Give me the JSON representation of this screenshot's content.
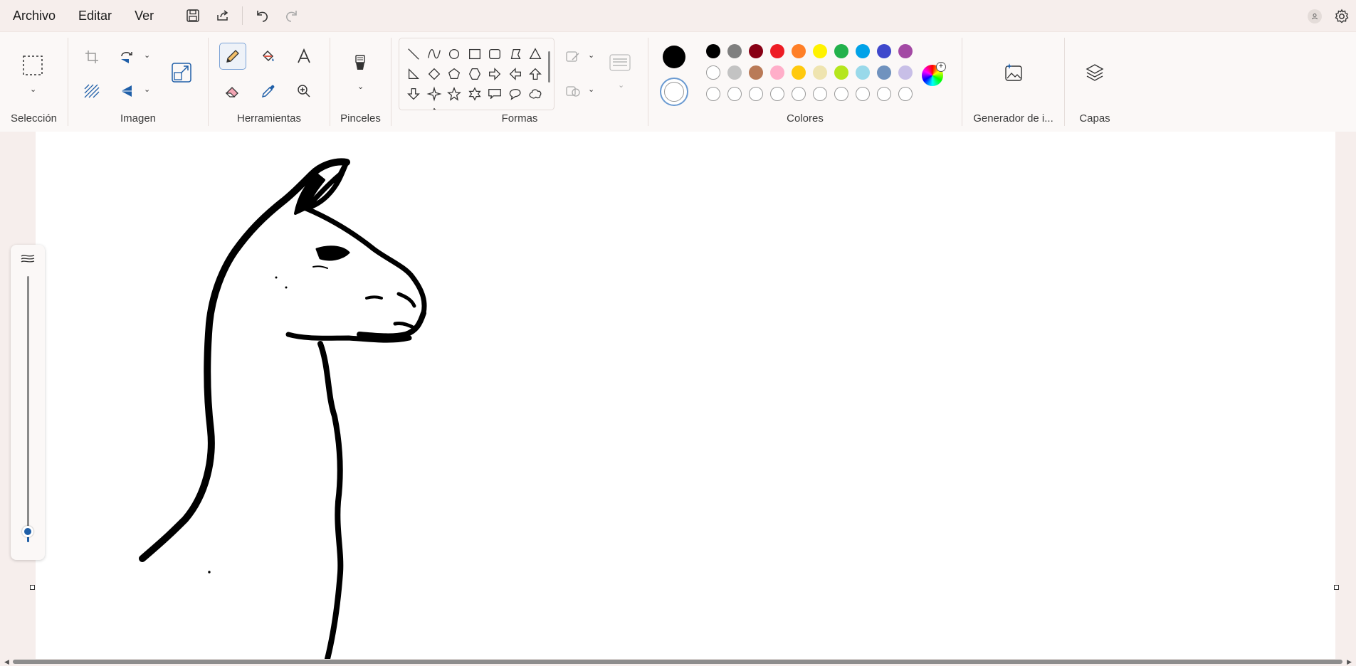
{
  "menu": {
    "items": [
      {
        "label": "Archivo",
        "name": "menu-archivo"
      },
      {
        "label": "Editar",
        "name": "menu-editar"
      },
      {
        "label": "Ver",
        "name": "menu-ver"
      }
    ]
  },
  "quick_access": [
    "save-icon",
    "share-icon",
    "undo-icon",
    "redo-icon"
  ],
  "ribbon": {
    "groups": {
      "seleccion": "Selección",
      "imagen": "Imagen",
      "herramientas": "Herramientas",
      "pinceles": "Pinceles",
      "formas": "Formas",
      "colores": "Colores",
      "generador": "Generador de i...",
      "capas": "Capas"
    },
    "active_tool": "pencil",
    "current_color_1": "#000000",
    "current_color_2": "#ffffff",
    "palette": [
      [
        "#000000",
        "#7f7f7f",
        "#880015",
        "#ed1c24",
        "#ff7f27",
        "#fff200",
        "#22b14c",
        "#00a2e8",
        "#3f48cc",
        "#a349a4"
      ],
      [
        "#ffffff",
        "#c3c3c3",
        "#b97a57",
        "#ffaec9",
        "#ffc90e",
        "#efe4b0",
        "#b5e61d",
        "#99d9ea",
        "#7092be",
        "#c8bfe7"
      ],
      [
        "",
        "",
        "",
        "",
        "",
        "",
        "",
        "",
        "",
        ""
      ]
    ],
    "shapes": [
      "line-shape",
      "curve-shape",
      "oval-shape",
      "rectangle-shape",
      "rounded-rectangle-shape",
      "polygon-shape",
      "triangle-shape",
      "right-triangle-shape",
      "diamond-shape",
      "pentagon-shape",
      "hexagon-shape",
      "right-arrow-shape",
      "left-arrow-shape",
      "up-arrow-shape",
      "down-arrow-shape",
      "four-point-star-shape",
      "five-point-star-shape",
      "six-point-star-shape",
      "rect-callout-shape",
      "oval-callout-shape",
      "cloud-callout-shape",
      "heart-shape",
      "lightning-shape"
    ]
  },
  "canvas": {
    "drawing": "llama-sketch",
    "brush_size_level": 0.04
  }
}
